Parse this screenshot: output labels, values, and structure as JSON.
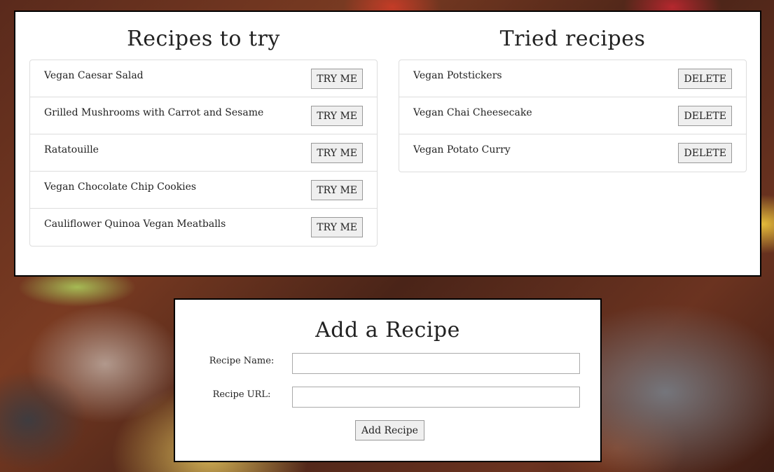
{
  "to_try": {
    "title": "Recipes to try",
    "button_label": "TRY ME",
    "items": [
      {
        "name": "Vegan Caesar Salad"
      },
      {
        "name": "Grilled Mushrooms with Carrot and Sesame"
      },
      {
        "name": "Ratatouille"
      },
      {
        "name": "Vegan Chocolate Chip Cookies"
      },
      {
        "name": "Cauliflower Quinoa Vegan Meatballs"
      }
    ]
  },
  "tried": {
    "title": "Tried recipes",
    "button_label": "DELETE",
    "items": [
      {
        "name": "Vegan Potstickers"
      },
      {
        "name": "Vegan Chai Cheesecake"
      },
      {
        "name": "Vegan Potato Curry"
      }
    ]
  },
  "add_form": {
    "title": "Add a Recipe",
    "name_label": "Recipe Name:",
    "name_value": "",
    "url_label": "Recipe URL:",
    "url_value": "",
    "submit_label": "Add Recipe"
  }
}
